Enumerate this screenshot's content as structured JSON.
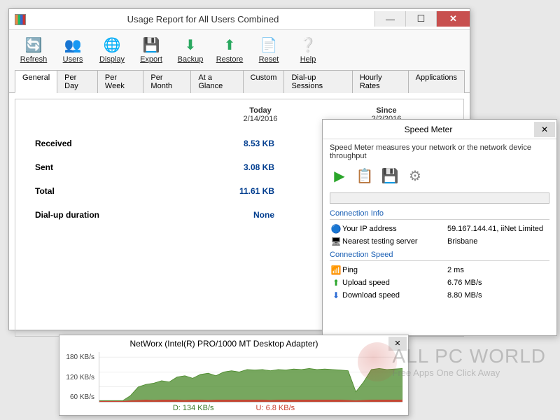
{
  "usage": {
    "title": "Usage Report for All Users Combined",
    "toolbar": [
      {
        "name": "refresh",
        "icon": "🔄",
        "label": "Refresh",
        "color": "#2b7fd4"
      },
      {
        "name": "users",
        "icon": "👥",
        "label": "Users",
        "color": "#e6a83a"
      },
      {
        "name": "display",
        "icon": "🌐",
        "label": "Display",
        "color": "#2aa860"
      },
      {
        "name": "export",
        "icon": "💾",
        "label": "Export",
        "color": "#888"
      },
      {
        "name": "backup",
        "icon": "⬇",
        "label": "Backup",
        "color": "#2aa860"
      },
      {
        "name": "restore",
        "icon": "⬆",
        "label": "Restore",
        "color": "#2aa860"
      },
      {
        "name": "reset",
        "icon": "📄",
        "label": "Reset",
        "color": "#888"
      },
      {
        "name": "help",
        "icon": "❔",
        "label": "Help",
        "color": "#3a7fd4"
      }
    ],
    "tabs": [
      "General",
      "Per Day",
      "Per Week",
      "Per Month",
      "At a Glance",
      "Custom",
      "Dial-up Sessions",
      "Hourly Rates",
      "Applications"
    ],
    "active_tab": 0,
    "col_today_label": "Today",
    "col_today_date": "2/14/2016",
    "col_since_label": "Since",
    "col_since_date": "2/2/2016",
    "rows": [
      {
        "label": "Received",
        "today": "8.53 KB"
      },
      {
        "label": "Sent",
        "today": "3.08 KB"
      },
      {
        "label": "Total",
        "today": "11.61 KB"
      },
      {
        "label": "Dial-up duration",
        "today": "None"
      }
    ]
  },
  "speed": {
    "title": "Speed Meter",
    "desc": "Speed Meter measures your network or the network device throughput",
    "icon_play": "▶",
    "icon_clip": "📋",
    "icon_save": "💾",
    "icon_gear": "⚙",
    "conn_info_title": "Connection Info",
    "ip_label": "Your IP address",
    "ip_value": "59.167.144.41, iiNet Limited",
    "server_label": "Nearest testing server",
    "server_value": "Brisbane",
    "conn_speed_title": "Connection Speed",
    "ping_label": "Ping",
    "ping_value": "2 ms",
    "upload_label": "Upload speed",
    "upload_value": "6.76 MB/s",
    "download_label": "Download speed",
    "download_value": "8.80 MB/s"
  },
  "graph": {
    "title": "NetWorx (Intel(R) PRO/1000 MT Desktop Adapter)",
    "y_ticks": [
      "180 KB/s",
      "120 KB/s",
      "60 KB/s"
    ],
    "legend_d": "D: 134 KB/s",
    "legend_u": "U: 6.8 KB/s"
  },
  "watermark": {
    "big": "ALL PC WORLD",
    "small": "Free Apps One Click Away"
  },
  "chart_data": {
    "type": "area",
    "title": "NetWorx (Intel(R) PRO/1000 MT Desktop Adapter)",
    "ylabel": "KB/s",
    "ylim": [
      0,
      200
    ],
    "x": [
      0,
      1,
      2,
      3,
      4,
      5,
      6,
      7,
      8,
      9,
      10,
      11,
      12,
      13,
      14,
      15,
      16,
      17,
      18,
      19,
      20,
      21,
      22,
      23,
      24,
      25,
      26,
      27,
      28,
      29,
      30,
      31,
      32,
      33,
      34,
      35,
      36,
      37,
      38,
      39
    ],
    "series": [
      {
        "name": "Download",
        "color": "#4a8a2a",
        "values": [
          5,
          5,
          5,
          5,
          25,
          60,
          70,
          75,
          85,
          80,
          100,
          105,
          95,
          110,
          115,
          105,
          120,
          125,
          120,
          130,
          128,
          130,
          125,
          130,
          128,
          132,
          130,
          134,
          130,
          132,
          130,
          128,
          125,
          40,
          80,
          130,
          134,
          130,
          132,
          134
        ]
      },
      {
        "name": "Upload",
        "color": "#c84030",
        "values": [
          2,
          2,
          2,
          2,
          4,
          6,
          7,
          6,
          7,
          7,
          7,
          6,
          7,
          7,
          6,
          7,
          7,
          7,
          7,
          7,
          7,
          7,
          6,
          7,
          7,
          7,
          7,
          7,
          7,
          7,
          7,
          7,
          6,
          4,
          6,
          7,
          7,
          7,
          7,
          7
        ]
      }
    ],
    "current": {
      "download_kbs": 134,
      "upload_kbs": 6.8
    }
  }
}
